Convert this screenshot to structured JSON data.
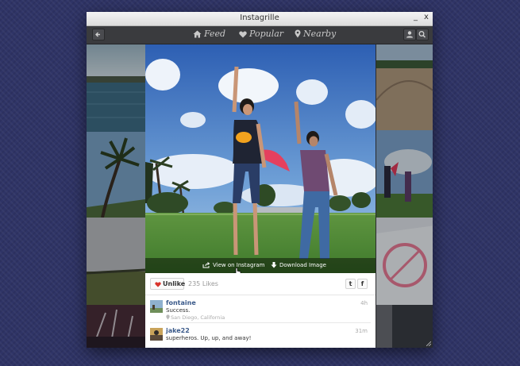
{
  "window": {
    "title": "Instagrille",
    "minimize": "_",
    "close": "x"
  },
  "toolbar": {
    "nav": [
      {
        "label": "Feed",
        "icon": "home-icon"
      },
      {
        "label": "Popular",
        "icon": "heart-icon"
      },
      {
        "label": "Nearby",
        "icon": "location-pin-icon"
      }
    ],
    "left_buttons": [
      "back-arrow-icon"
    ],
    "right_buttons": [
      "user-icon",
      "search-icon"
    ]
  },
  "photo_actions": {
    "view": "View on Instagram",
    "download": "Download Image"
  },
  "likes": {
    "unlike_label": "Unlike",
    "count_text": "235 Likes"
  },
  "share": {
    "twitter": "t",
    "facebook": "f"
  },
  "comments": [
    {
      "user": "fontaine",
      "text": "Success.",
      "location": "San Diego, California",
      "time": "4h"
    },
    {
      "user": "jake22",
      "text": "superheros. Up, up, and away!",
      "time": "31m"
    }
  ],
  "colors": {
    "background": "#2f3466",
    "heart": "#d9342b",
    "username": "#3b5a8a"
  }
}
